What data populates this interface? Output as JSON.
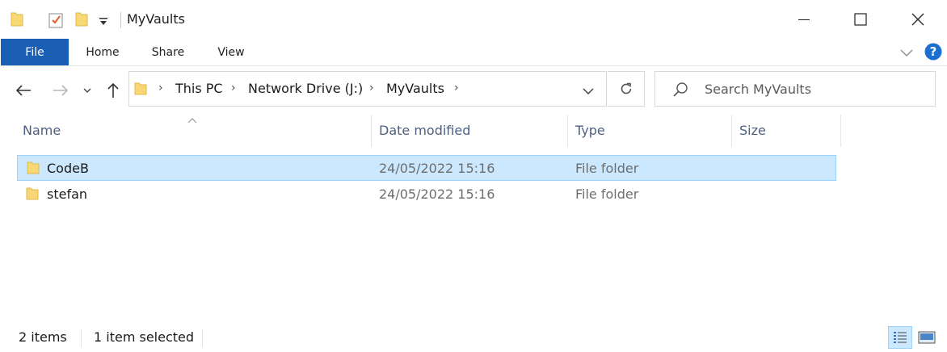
{
  "window": {
    "title": "MyVaults"
  },
  "ribbon": {
    "tabs": [
      "File",
      "Home",
      "Share",
      "View"
    ]
  },
  "address": {
    "crumbs": [
      "This PC",
      "Network Drive (J:)",
      "MyVaults"
    ]
  },
  "search": {
    "placeholder": "Search MyVaults"
  },
  "columns": [
    "Name",
    "Date modified",
    "Type",
    "Size"
  ],
  "files": [
    {
      "name": "CodeB",
      "date": "24/05/2022 15:16",
      "type": "File folder",
      "size": "",
      "selected": true
    },
    {
      "name": "stefan",
      "date": "24/05/2022 15:16",
      "type": "File folder",
      "size": "",
      "selected": false
    }
  ],
  "status": {
    "count": "2 items",
    "selection": "1 item selected"
  },
  "colors": {
    "accent": "#1a5fb4",
    "selection_bg": "#cce8ff",
    "selection_border": "#99d1ff",
    "folder": "#f8d775",
    "help": "#1a6fd1"
  }
}
